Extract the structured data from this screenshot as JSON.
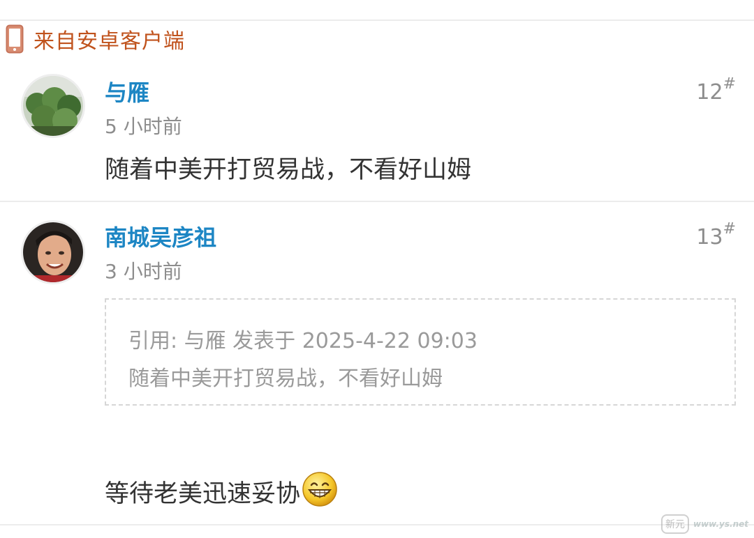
{
  "source": {
    "label": "来自安卓客户端"
  },
  "posts": [
    {
      "username": "与雁",
      "time": "5 小时前",
      "floor": "12",
      "floor_mark": "#",
      "content": "随着中美开打贸易战，不看好山姆"
    },
    {
      "username": "南城吴彦祖",
      "time": "3 小时前",
      "floor": "13",
      "floor_mark": "#",
      "quote": {
        "header": "引用: 与雁 发表于 2025-4-22 09:03",
        "text": "随着中美开打贸易战，不看好山姆"
      },
      "content": "等待老美迅速妥协",
      "emoji": "grinning-face-icon"
    }
  ],
  "watermark": {
    "badge": "新元",
    "text": "www.ys.net"
  },
  "colors": {
    "username": "#1d86c4",
    "source": "#c0521c",
    "meta": "#8d8d8d",
    "body": "#333333"
  }
}
